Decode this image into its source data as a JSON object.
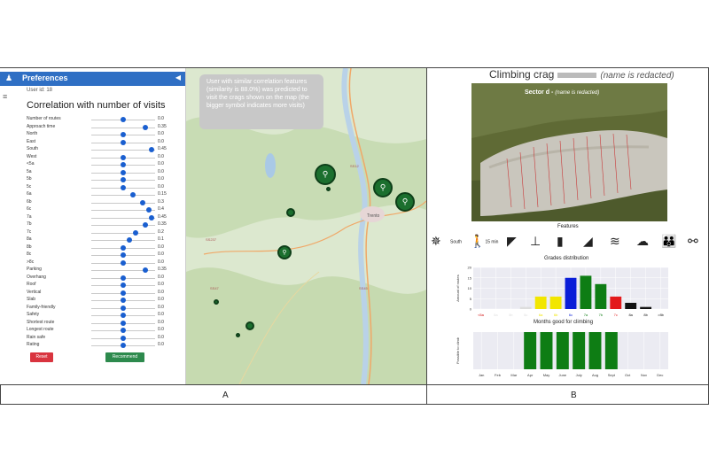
{
  "captions": {
    "a": "A",
    "b": "B"
  },
  "sidebar": {
    "user_label": "♟",
    "title": "Preferences",
    "collapse_icon": "◀",
    "menu_icon": "≡",
    "user_id": "User id: 18",
    "section_title": "Correlation with number of visits",
    "rows": [
      {
        "label": "Number of routes",
        "value": "0.0"
      },
      {
        "label": "Approach time",
        "value": "0.35"
      },
      {
        "label": "North",
        "value": "0.0"
      },
      {
        "label": "East",
        "value": "0.0"
      },
      {
        "label": "South",
        "value": "0.45"
      },
      {
        "label": "West",
        "value": "0.0"
      },
      {
        "label": "<5a",
        "value": "0.0"
      },
      {
        "label": "5a",
        "value": "0.0"
      },
      {
        "label": "5b",
        "value": "0.0"
      },
      {
        "label": "5c",
        "value": "0.0"
      },
      {
        "label": "6a",
        "value": "0.15"
      },
      {
        "label": "6b",
        "value": "0.3"
      },
      {
        "label": "6c",
        "value": "0.4"
      },
      {
        "label": "7a",
        "value": "0.45"
      },
      {
        "label": "7b",
        "value": "0.35"
      },
      {
        "label": "7c",
        "value": "0.2"
      },
      {
        "label": "8a",
        "value": "0.1"
      },
      {
        "label": "8b",
        "value": "0.0"
      },
      {
        "label": "8c",
        "value": "0.0"
      },
      {
        "label": ">8c",
        "value": "0.0"
      },
      {
        "label": "Parking",
        "value": "0.35"
      },
      {
        "label": "Overhang",
        "value": "0.0"
      },
      {
        "label": "Roof",
        "value": "0.0"
      },
      {
        "label": "Vertical",
        "value": "0.0"
      },
      {
        "label": "Slab",
        "value": "0.0"
      },
      {
        "label": "Family-friendly",
        "value": "0.0"
      },
      {
        "label": "Safety",
        "value": "0.0"
      },
      {
        "label": "Shortest route",
        "value": "0.0"
      },
      {
        "label": "Longest route",
        "value": "0.0"
      },
      {
        "label": "Rain safe",
        "value": "0.0"
      },
      {
        "label": "Rating",
        "value": "0.0"
      }
    ],
    "reset_label": "Reset",
    "recommend_label": "Recommend"
  },
  "map": {
    "tooltip": "User with similar correlation features (similarity is 88.0%) was predicted to visit the crags shown on the map (the bigger symbol indicates more visits)",
    "climber_icon": "climber-icon",
    "town_label": "Trento",
    "road_labels": [
      "SS237",
      "SS12",
      "SS45",
      "SS47"
    ],
    "colors": {
      "pin": "#1b6f2e",
      "water": "#a9c9e6",
      "road": "#f0a868",
      "forest": "#c8dcb4"
    }
  },
  "crag": {
    "title": "Climbing crag",
    "title_note": "(name is redacted)",
    "sector": "Sector d -",
    "sector_note": "(name is redacted)",
    "features_title": "Features",
    "features": [
      {
        "icon": "compass-icon",
        "glyph": "✵",
        "text": ""
      },
      {
        "icon": "exposure-label",
        "glyph": "",
        "text": "South"
      },
      {
        "icon": "hiker-icon",
        "glyph": "🚶",
        "text": "15 min"
      },
      {
        "icon": "overhang-icon",
        "glyph": "◤",
        "text": ""
      },
      {
        "icon": "roof-icon",
        "glyph": "⊥",
        "text": ""
      },
      {
        "icon": "vertical-icon",
        "glyph": "▮",
        "text": ""
      },
      {
        "icon": "slab-icon",
        "glyph": "◢",
        "text": ""
      },
      {
        "icon": "rope-icon",
        "glyph": "≋",
        "text": ""
      },
      {
        "icon": "rain-icon",
        "glyph": "☁",
        "text": ""
      },
      {
        "icon": "family-icon",
        "glyph": "👪",
        "text": ""
      },
      {
        "icon": "bolt-icon",
        "glyph": "⚯",
        "text": ""
      }
    ]
  },
  "chart_data": [
    {
      "type": "bar",
      "title": "Grades distribution",
      "ylabel": "Amount of routes",
      "categories": [
        "<5a",
        "5a",
        "5b",
        "5c",
        "6a",
        "6b",
        "6c",
        "7a",
        "7b",
        "7c",
        "8a",
        "8b",
        ">8b"
      ],
      "values": [
        0,
        0,
        0,
        1,
        6,
        6,
        15,
        16,
        12,
        6,
        3,
        1,
        0
      ],
      "colors": [
        "#d00000",
        "#dddddd",
        "#dddddd",
        "#dddddd",
        "#f2e600",
        "#f2e600",
        "#0a1ed8",
        "#0e7d14",
        "#0e7d14",
        "#e31a1c",
        "#111111",
        "#111111",
        "#111111"
      ],
      "yticks": [
        0,
        5,
        10,
        15,
        20
      ],
      "ylim": [
        0,
        20
      ],
      "grid": true
    },
    {
      "type": "bar",
      "title": "Months good for climbing",
      "ylabel": "Possible to climb",
      "categories": [
        "Jan",
        "Feb",
        "Mar",
        "Apr",
        "May",
        "June",
        "July",
        "Aug",
        "Sept",
        "Oct",
        "Nov",
        "Dec"
      ],
      "values": [
        0,
        0,
        0,
        1,
        1,
        1,
        1,
        1,
        1,
        0,
        0,
        0
      ],
      "colors": [
        "#0e7d14"
      ],
      "ylim": [
        0,
        1
      ],
      "grid": true
    }
  ]
}
